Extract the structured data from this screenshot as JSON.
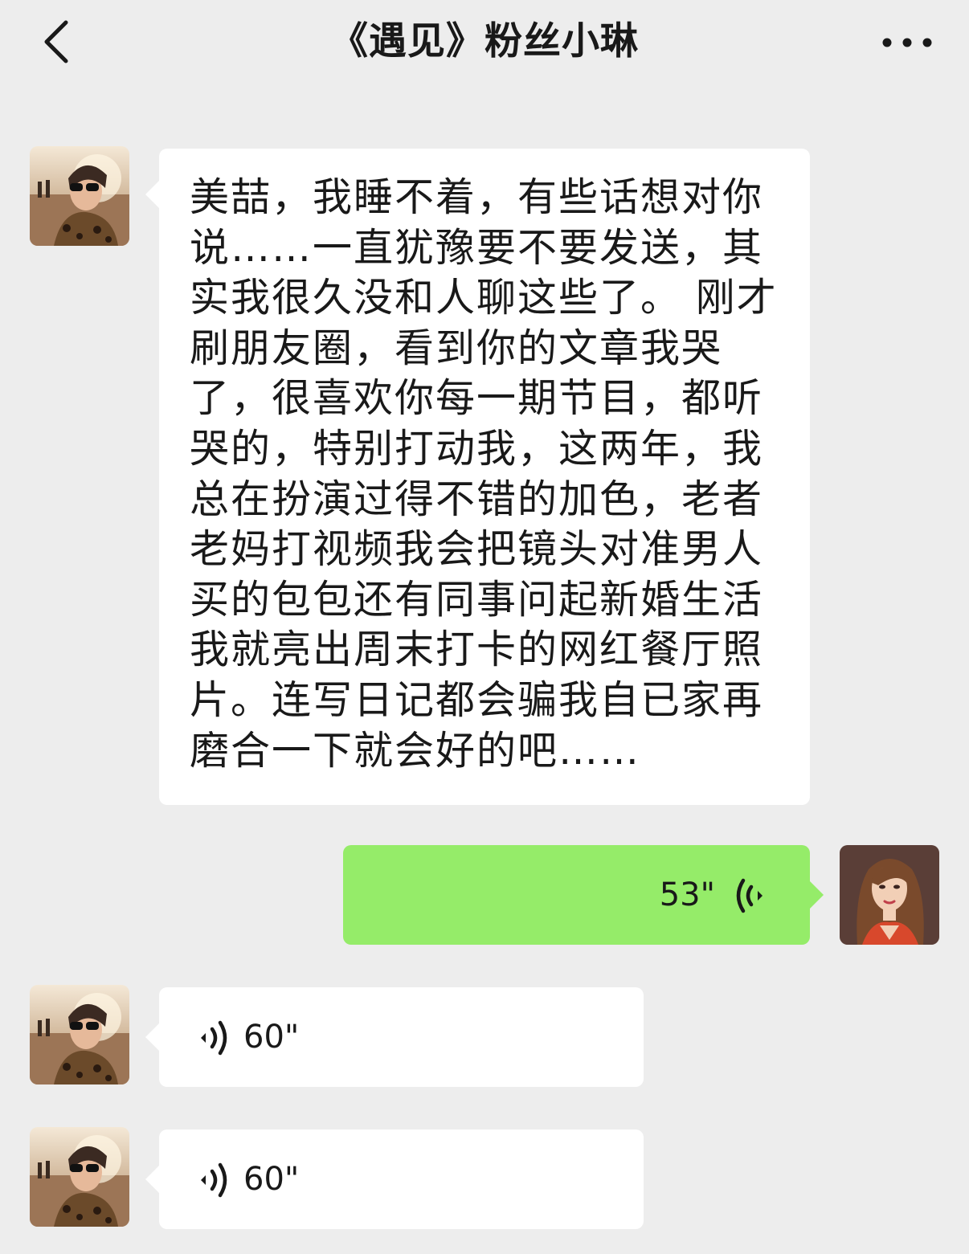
{
  "header": {
    "title": "《遇见》粉丝小琳",
    "back_icon": "chevron-left-icon",
    "more_icon": "more-dots-icon"
  },
  "messages": [
    {
      "side": "incoming",
      "type": "text",
      "text": "美喆，我睡不着，有些话想对你说……一直犹豫要不要发送，其实我很久没和人聊这些了。 刚才刷朋友圈，看到你的文章我哭了，很喜欢你每一期节目，都听哭的，特别打动我，这两年，我总在扮演过得不错的加色，老者老妈打视频我会把镜头对准男人买的包包还有同事问起新婚生活我就亮出周末打卡的网红餐厅照片。连写日记都会骗我自已家再磨合一下就会好的吧……"
    },
    {
      "side": "outgoing",
      "type": "voice",
      "duration": "53\""
    },
    {
      "side": "incoming",
      "type": "voice",
      "duration": "60\""
    },
    {
      "side": "incoming",
      "type": "voice",
      "duration": "60\""
    }
  ],
  "colors": {
    "background": "#ededed",
    "incoming_bubble": "#ffffff",
    "outgoing_bubble": "#95ec69"
  }
}
